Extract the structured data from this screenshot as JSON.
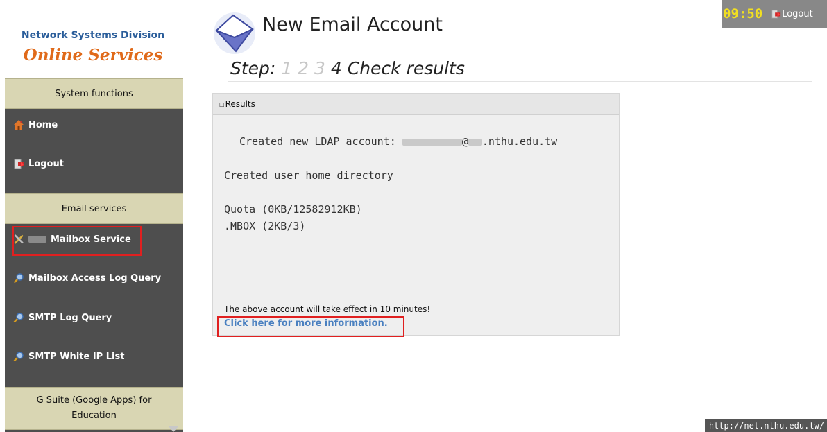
{
  "brand": {
    "line1": "Network Systems Division",
    "line2": "Online Services"
  },
  "sidebar": {
    "sections": [
      {
        "title": "System functions",
        "items": [
          {
            "label": "Home",
            "icon": "home-icon"
          },
          {
            "label": "Logout",
            "icon": "logout-icon"
          }
        ]
      },
      {
        "title": "Email services",
        "items": [
          {
            "label": "Mailbox Service",
            "icon": "tools-icon",
            "highlighted": true
          },
          {
            "label": "Mailbox Access Log Query",
            "icon": "magnifier-icon"
          },
          {
            "label": "SMTP Log Query",
            "icon": "magnifier-icon"
          },
          {
            "label": "SMTP White IP List",
            "icon": "magnifier-icon"
          }
        ]
      },
      {
        "title": "G Suite (Google Apps) for Education",
        "items": []
      }
    ]
  },
  "header": {
    "title": "New Email Account",
    "step_label": "Step:",
    "steps_done": [
      "1",
      "2",
      "3"
    ],
    "current_step": "4 Check results"
  },
  "results": {
    "title": "Results",
    "ldap_prefix": "Created new LDAP account:",
    "ldap_suffix": ".nthu.edu.tw",
    "home_dir": "Created user home directory",
    "quota": "Quota (0KB/12582912KB)",
    "mbox": ".MBOX (2KB/3)",
    "note": "The above account will take effect in 10 minutes!",
    "link": "Click here for more information."
  },
  "topbar": {
    "time": "09:50",
    "logout": "Logout"
  },
  "footer_url": "http://net.nthu.edu.tw/",
  "colors": {
    "sidebar_bg": "#4e4e4e",
    "section_head_bg": "#d9d6b3",
    "highlight_red": "#e02020",
    "clock_yellow": "#f2e020",
    "brand_blue": "#2a5d9a",
    "brand_orange": "#e06a1a",
    "link_blue": "#4a80c0"
  }
}
